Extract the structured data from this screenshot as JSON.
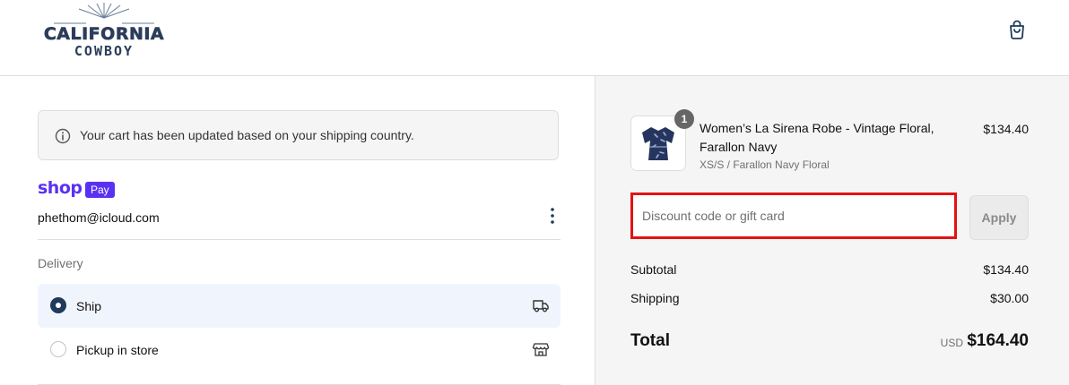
{
  "brand": {
    "logo_line1": "CALIFORNIA",
    "logo_line2": "COWBOY"
  },
  "header": {
    "cart_icon": "shopping-bag-icon"
  },
  "notice": {
    "icon": "info-icon",
    "text": "Your cart has been updated based on your shipping country."
  },
  "shop_pay": {
    "shop": "shop",
    "pay": "Pay"
  },
  "account": {
    "email": "phethom@icloud.com",
    "menu_icon": "kebab-menu-icon"
  },
  "delivery": {
    "label": "Delivery",
    "options": [
      {
        "label": "Ship",
        "selected": true,
        "icon": "truck-icon"
      },
      {
        "label": "Pickup in store",
        "selected": false,
        "icon": "store-icon"
      }
    ]
  },
  "order": {
    "item": {
      "quantity": "1",
      "name": "Women’s La Sirena Robe - Vintage Floral, Farallon Navy",
      "variant": "XS/S / Farallon Navy Floral",
      "price": "$134.40"
    },
    "discount": {
      "placeholder": "Discount code or gift card",
      "value": ""
    },
    "apply_label": "Apply",
    "subtotal_label": "Subtotal",
    "subtotal": "$134.40",
    "shipping_label": "Shipping",
    "shipping": "$30.00",
    "total_label": "Total",
    "currency": "USD",
    "total": "$164.40"
  },
  "colors": {
    "accent": "#1f3a5a",
    "shop_pay": "#5a31f4",
    "highlight": "#e31313"
  }
}
